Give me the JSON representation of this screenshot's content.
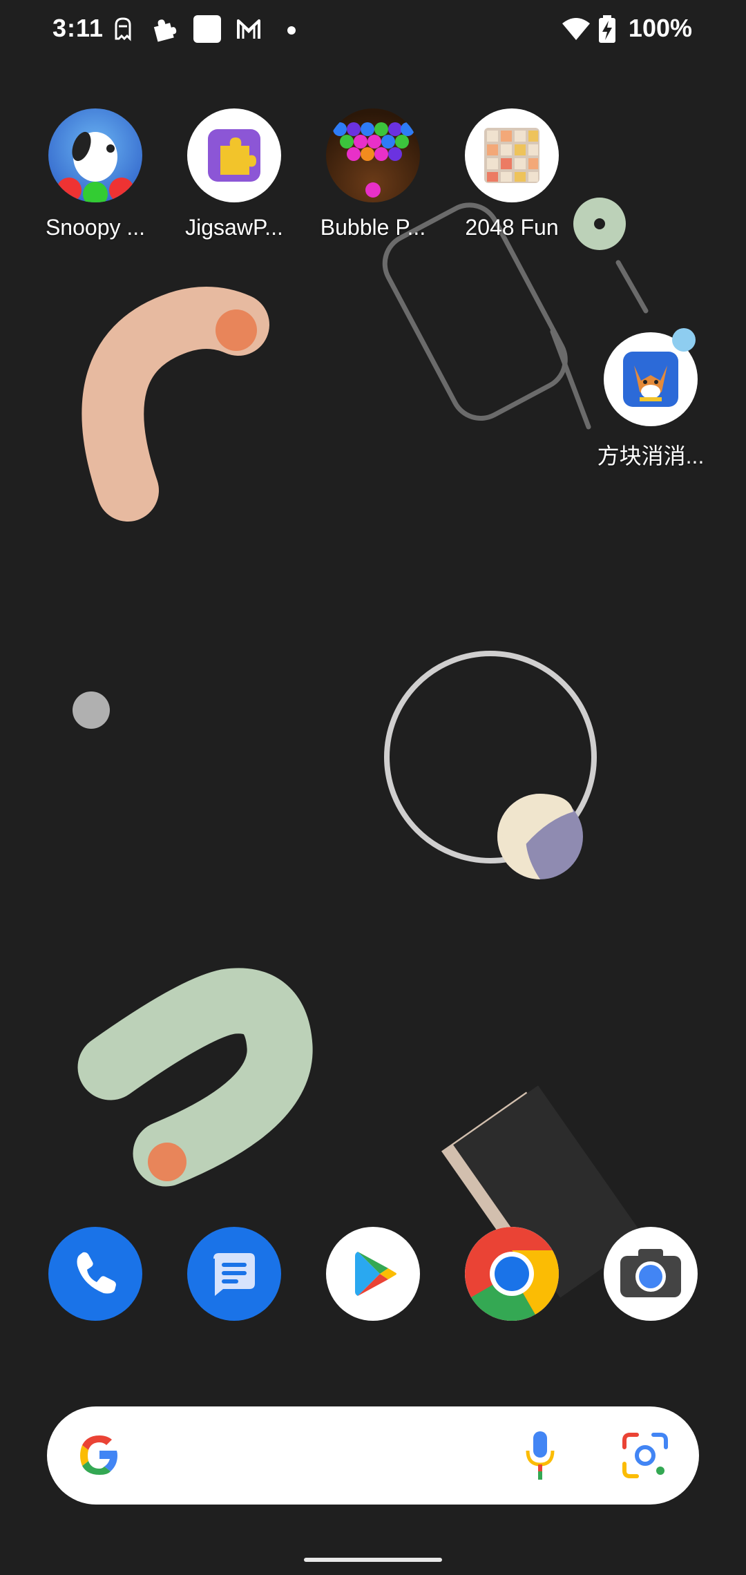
{
  "status_bar": {
    "time": "3:11",
    "battery_percent": "100%",
    "left_icons": [
      "ghost-notification-icon",
      "puzzle-notification-icon",
      "square-notification-icon",
      "gmail-icon",
      "more-notifications-dot-icon"
    ],
    "right_icons": [
      "wifi-icon",
      "battery-charging-icon"
    ]
  },
  "home": {
    "apps": [
      {
        "label": "Snoopy ...",
        "icon": "snoopy-pop-icon"
      },
      {
        "label": "JigsawP...",
        "icon": "jigsaw-puzzle-icon"
      },
      {
        "label": "Bubble P...",
        "icon": "bubble-pop-icon"
      },
      {
        "label": "2048 Fun",
        "icon": "2048-fun-icon"
      },
      {
        "label": "方块消消...",
        "icon": "block-match-fox-icon",
        "has_notification": true
      }
    ]
  },
  "dock": {
    "apps": [
      {
        "name": "Phone",
        "icon": "phone-icon"
      },
      {
        "name": "Messages",
        "icon": "messages-icon"
      },
      {
        "name": "Play Store",
        "icon": "play-store-icon"
      },
      {
        "name": "Chrome",
        "icon": "chrome-icon"
      },
      {
        "name": "Camera",
        "icon": "camera-icon"
      }
    ]
  },
  "search": {
    "icons": [
      "google-g-icon",
      "microphone-icon",
      "google-lens-icon"
    ]
  },
  "colors": {
    "background": "#1f1f1f",
    "accent_blue": "#1a73e8",
    "notification_dot": "#8ecdf0"
  }
}
